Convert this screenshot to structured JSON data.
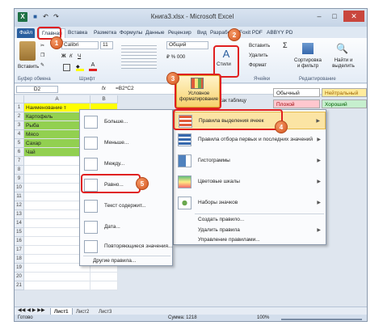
{
  "window": {
    "title": "Книга3.xlsx - Microsoft Excel",
    "minimize": "–",
    "maximize": "□",
    "close": "✕"
  },
  "quick_access": {
    "save": "■",
    "undo": "↶",
    "redo": "↷"
  },
  "tabs": [
    "Файл",
    "Главная",
    "Вставка",
    "Разметка",
    "Формулы",
    "Данные",
    "Рецензир",
    "Вид",
    "Разработ",
    "Foxit PDF",
    "ABBYY PD"
  ],
  "ribbon": {
    "paste": "Вставить",
    "clipboard": "Буфер обмена",
    "font_name": "Calibri",
    "font_size": "11",
    "font": "Шрифт",
    "number_format": "Общий",
    "styles": "Стили",
    "insert": "Вставить",
    "delete": "Удалить",
    "format": "Формат",
    "cells": "Ячейки",
    "sigma": "Σ",
    "sort_filter": "Сортировка и фильтр",
    "find_select": "Найти и выделить",
    "editing": "Редактирование",
    "conditional_format": "Условное форматирование",
    "format_as_table": "как таблицу",
    "style_normal": "Обычный",
    "style_neutral": "Нейтральный",
    "style_bad": "Плохой",
    "style_good": "Хороший"
  },
  "formula_bar": {
    "cell_ref": "D2",
    "fx": "fx",
    "formula": "=B2*C2"
  },
  "columns": [
    "A",
    "B"
  ],
  "rows": [
    {
      "num": "1",
      "a": "Наименование т"
    },
    {
      "num": "2",
      "a": "Картофель"
    },
    {
      "num": "3",
      "a": "Рыба"
    },
    {
      "num": "4",
      "a": "Мясо"
    },
    {
      "num": "5",
      "a": "Сахар"
    },
    {
      "num": "6",
      "a": "Чай"
    },
    {
      "num": "7",
      "a": ""
    },
    {
      "num": "8",
      "a": ""
    },
    {
      "num": "9",
      "a": ""
    },
    {
      "num": "10",
      "a": ""
    },
    {
      "num": "11",
      "a": ""
    },
    {
      "num": "12",
      "a": ""
    },
    {
      "num": "13",
      "a": ""
    },
    {
      "num": "14",
      "a": ""
    },
    {
      "num": "15",
      "a": ""
    },
    {
      "num": "16",
      "a": ""
    },
    {
      "num": "17",
      "a": ""
    },
    {
      "num": "18",
      "a": ""
    },
    {
      "num": "19",
      "a": ""
    },
    {
      "num": "20",
      "a": ""
    },
    {
      "num": "21",
      "a": ""
    }
  ],
  "cf_menu": {
    "highlight_rules": "Правила выделения ячеек",
    "top_bottom": "Правила отбора первых и последних значений",
    "histograms": "Гистограммы",
    "color_scales": "Цветовые шкалы",
    "icon_sets": "Наборы значков",
    "new_rule": "Создать правило...",
    "clear_rules": "Удалить правила",
    "manage_rules": "Управление правилами..."
  },
  "sub_menu": {
    "greater": "Больше...",
    "less": "Меньше...",
    "between": "Между...",
    "equal": "Равно...",
    "text_contains": "Текст содержит...",
    "date": "Дата...",
    "duplicates": "Повторяющиеся значения...",
    "other_rules": "Другие правила..."
  },
  "callouts": [
    "1",
    "2",
    "3",
    "4",
    "5"
  ],
  "sheets": [
    "Лист1",
    "Лист2",
    "Лист3"
  ],
  "status": {
    "ready": "Готово",
    "sum": "Сумма: 1218",
    "zoom": "100%"
  },
  "colors": {
    "accent": "#2a5f9f",
    "highlight_yellow": "#ffff00",
    "green_cells": "#92d050",
    "red": "#e02020",
    "callout": "#e0652a"
  }
}
